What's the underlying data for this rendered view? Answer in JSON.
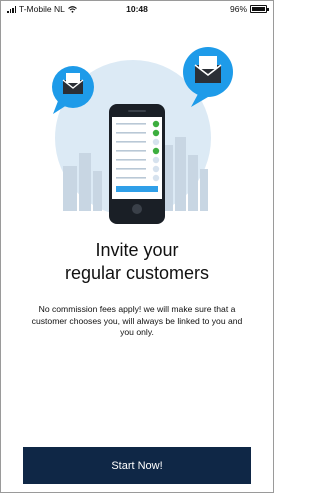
{
  "status_bar": {
    "carrier": "T-Mobile NL",
    "time": "10:48",
    "battery": "96%"
  },
  "illustration": {
    "icons": [
      "envelope-icon",
      "phone-icon",
      "checkmark-icon",
      "city-skyline"
    ],
    "colors": {
      "circle": "#dceaf5",
      "skyline": "#c8d6e3",
      "bubble": "#1e9be9",
      "phone_body": "#1a1f26",
      "screen_bar": "#2f9fe8",
      "check": "#3cae3e"
    }
  },
  "headline": {
    "line1": "Invite your",
    "line2": "regular customers"
  },
  "description": "No commission fees apply! we will make sure that a customer chooses you, will always be linked to you and you only.",
  "cta": {
    "label": "Start Now!",
    "color": "#0f2746"
  }
}
